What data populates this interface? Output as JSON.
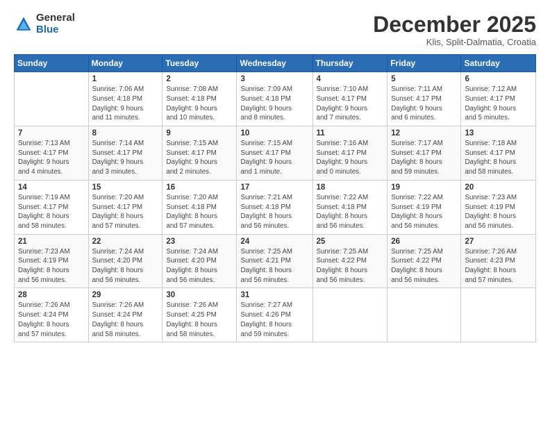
{
  "header": {
    "logo_general": "General",
    "logo_blue": "Blue",
    "month_title": "December 2025",
    "location": "Klis, Split-Dalmatia, Croatia"
  },
  "calendar": {
    "headers": [
      "Sunday",
      "Monday",
      "Tuesday",
      "Wednesday",
      "Thursday",
      "Friday",
      "Saturday"
    ],
    "weeks": [
      [
        {
          "day": "",
          "info": ""
        },
        {
          "day": "1",
          "info": "Sunrise: 7:06 AM\nSunset: 4:18 PM\nDaylight: 9 hours\nand 11 minutes."
        },
        {
          "day": "2",
          "info": "Sunrise: 7:08 AM\nSunset: 4:18 PM\nDaylight: 9 hours\nand 10 minutes."
        },
        {
          "day": "3",
          "info": "Sunrise: 7:09 AM\nSunset: 4:18 PM\nDaylight: 9 hours\nand 8 minutes."
        },
        {
          "day": "4",
          "info": "Sunrise: 7:10 AM\nSunset: 4:17 PM\nDaylight: 9 hours\nand 7 minutes."
        },
        {
          "day": "5",
          "info": "Sunrise: 7:11 AM\nSunset: 4:17 PM\nDaylight: 9 hours\nand 6 minutes."
        },
        {
          "day": "6",
          "info": "Sunrise: 7:12 AM\nSunset: 4:17 PM\nDaylight: 9 hours\nand 5 minutes."
        }
      ],
      [
        {
          "day": "7",
          "info": "Sunrise: 7:13 AM\nSunset: 4:17 PM\nDaylight: 9 hours\nand 4 minutes."
        },
        {
          "day": "8",
          "info": "Sunrise: 7:14 AM\nSunset: 4:17 PM\nDaylight: 9 hours\nand 3 minutes."
        },
        {
          "day": "9",
          "info": "Sunrise: 7:15 AM\nSunset: 4:17 PM\nDaylight: 9 hours\nand 2 minutes."
        },
        {
          "day": "10",
          "info": "Sunrise: 7:15 AM\nSunset: 4:17 PM\nDaylight: 9 hours\nand 1 minute."
        },
        {
          "day": "11",
          "info": "Sunrise: 7:16 AM\nSunset: 4:17 PM\nDaylight: 9 hours\nand 0 minutes."
        },
        {
          "day": "12",
          "info": "Sunrise: 7:17 AM\nSunset: 4:17 PM\nDaylight: 8 hours\nand 59 minutes."
        },
        {
          "day": "13",
          "info": "Sunrise: 7:18 AM\nSunset: 4:17 PM\nDaylight: 8 hours\nand 58 minutes."
        }
      ],
      [
        {
          "day": "14",
          "info": "Sunrise: 7:19 AM\nSunset: 4:17 PM\nDaylight: 8 hours\nand 58 minutes."
        },
        {
          "day": "15",
          "info": "Sunrise: 7:20 AM\nSunset: 4:17 PM\nDaylight: 8 hours\nand 57 minutes."
        },
        {
          "day": "16",
          "info": "Sunrise: 7:20 AM\nSunset: 4:18 PM\nDaylight: 8 hours\nand 57 minutes."
        },
        {
          "day": "17",
          "info": "Sunrise: 7:21 AM\nSunset: 4:18 PM\nDaylight: 8 hours\nand 56 minutes."
        },
        {
          "day": "18",
          "info": "Sunrise: 7:22 AM\nSunset: 4:18 PM\nDaylight: 8 hours\nand 56 minutes."
        },
        {
          "day": "19",
          "info": "Sunrise: 7:22 AM\nSunset: 4:19 PM\nDaylight: 8 hours\nand 56 minutes."
        },
        {
          "day": "20",
          "info": "Sunrise: 7:23 AM\nSunset: 4:19 PM\nDaylight: 8 hours\nand 56 minutes."
        }
      ],
      [
        {
          "day": "21",
          "info": "Sunrise: 7:23 AM\nSunset: 4:19 PM\nDaylight: 8 hours\nand 56 minutes."
        },
        {
          "day": "22",
          "info": "Sunrise: 7:24 AM\nSunset: 4:20 PM\nDaylight: 8 hours\nand 56 minutes."
        },
        {
          "day": "23",
          "info": "Sunrise: 7:24 AM\nSunset: 4:20 PM\nDaylight: 8 hours\nand 56 minutes."
        },
        {
          "day": "24",
          "info": "Sunrise: 7:25 AM\nSunset: 4:21 PM\nDaylight: 8 hours\nand 56 minutes."
        },
        {
          "day": "25",
          "info": "Sunrise: 7:25 AM\nSunset: 4:22 PM\nDaylight: 8 hours\nand 56 minutes."
        },
        {
          "day": "26",
          "info": "Sunrise: 7:25 AM\nSunset: 4:22 PM\nDaylight: 8 hours\nand 56 minutes."
        },
        {
          "day": "27",
          "info": "Sunrise: 7:26 AM\nSunset: 4:23 PM\nDaylight: 8 hours\nand 57 minutes."
        }
      ],
      [
        {
          "day": "28",
          "info": "Sunrise: 7:26 AM\nSunset: 4:24 PM\nDaylight: 8 hours\nand 57 minutes."
        },
        {
          "day": "29",
          "info": "Sunrise: 7:26 AM\nSunset: 4:24 PM\nDaylight: 8 hours\nand 58 minutes."
        },
        {
          "day": "30",
          "info": "Sunrise: 7:26 AM\nSunset: 4:25 PM\nDaylight: 8 hours\nand 58 minutes."
        },
        {
          "day": "31",
          "info": "Sunrise: 7:27 AM\nSunset: 4:26 PM\nDaylight: 8 hours\nand 59 minutes."
        },
        {
          "day": "",
          "info": ""
        },
        {
          "day": "",
          "info": ""
        },
        {
          "day": "",
          "info": ""
        }
      ]
    ]
  }
}
